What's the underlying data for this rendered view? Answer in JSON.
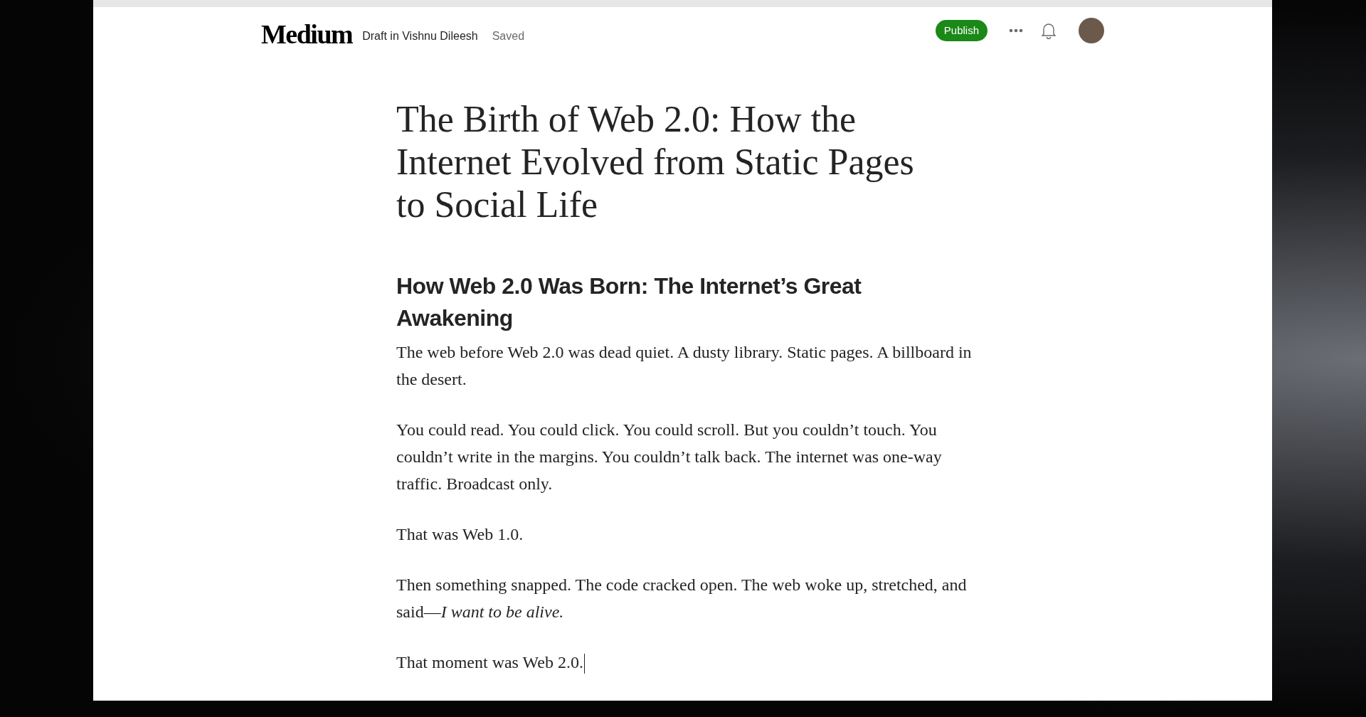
{
  "header": {
    "logo": "Medium",
    "draft_label": "Draft in Vishnu Dileesh",
    "save_status": "Saved",
    "publish_button": "Publish"
  },
  "article": {
    "title": "The Birth of Web 2.0: How the Internet Evolved from Static Pages to Social Life",
    "subheading": "How Web 2.0 Was Born: The Internet’s Great Awakening",
    "paragraphs": [
      "The web before Web 2.0 was dead quiet. A dusty library. Static pages. A billboard in the desert.",
      "You could read. You could click. You could scroll. But you couldn’t touch. You couldn’t write in the margins. You couldn’t talk back. The internet was one-way traffic. Broadcast only.",
      "That was Web 1.0.",
      "Then something snapped. The code cracked open. The web woke up, stretched, and said—*I want to be alive.*",
      "That moment was Web 2.0."
    ]
  }
}
